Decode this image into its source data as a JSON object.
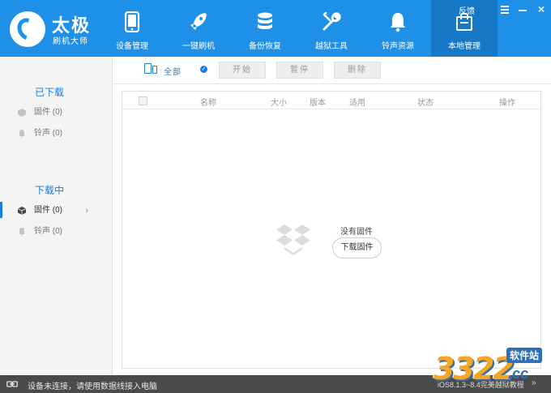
{
  "app": {
    "title": "太极",
    "subtitle": "刷机大师"
  },
  "nav": {
    "items": [
      {
        "label": "设备管理",
        "icon": "phone-icon"
      },
      {
        "label": "一键刷机",
        "icon": "rocket-icon"
      },
      {
        "label": "备份恢复",
        "icon": "database-icon"
      },
      {
        "label": "越狱工具",
        "icon": "wrench-icon"
      },
      {
        "label": "铃声资源",
        "icon": "bell-icon"
      },
      {
        "label": "本地管理",
        "icon": "bag-icon",
        "active": true
      }
    ]
  },
  "window": {
    "feedback": "反馈",
    "close": "×"
  },
  "sidebar": {
    "downloaded": {
      "title": "已下载",
      "items": [
        {
          "label": "固件 (0)",
          "icon": "cube-icon"
        },
        {
          "label": "铃声 (0)",
          "icon": "bell-icon"
        }
      ]
    },
    "downloading": {
      "title": "下载中",
      "items": [
        {
          "label": "固件 (0)",
          "icon": "cube-icon",
          "active": true
        },
        {
          "label": "铃声 (0)",
          "icon": "bell-icon"
        }
      ],
      "chevron": "›"
    }
  },
  "toolbar": {
    "filter_label": "全部",
    "check": "✓",
    "start_label": "开始",
    "pause_label": "暂停",
    "delete_label": "删除"
  },
  "table": {
    "columns": [
      "名称",
      "大小",
      "版本",
      "适用",
      "状态",
      "操作"
    ]
  },
  "empty": {
    "message": "没有固件",
    "button": "下载固件"
  },
  "status": {
    "text": "设备未连接，请使用数据线接入电脑",
    "right_text": "iOS8.1.3~8.4完美越狱教程",
    "arrows": "»"
  },
  "watermark": {
    "number": "3322",
    "cn": "软件站",
    "cc": ".cc"
  },
  "colors": {
    "header": "#1e90e8",
    "accent": "#1a7ed8",
    "statusbar": "#4a4a4a"
  }
}
